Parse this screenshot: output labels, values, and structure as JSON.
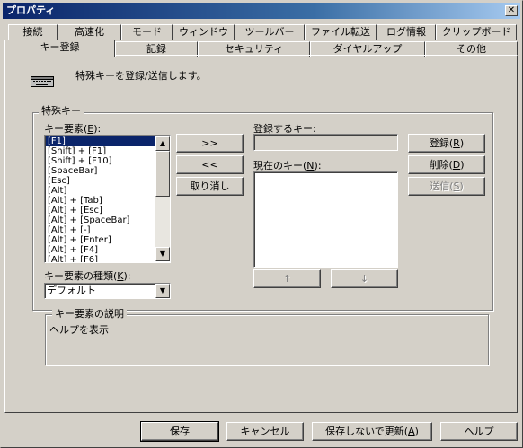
{
  "window": {
    "title": "プロパティ",
    "close": "✕"
  },
  "tabs_row1": [
    "接続",
    "高速化",
    "モード",
    "ウィンドウ",
    "ツールバー",
    "ファイル転送",
    "ログ情報",
    "クリップボード"
  ],
  "tabs_row2": [
    "キー登録",
    "記録",
    "セキュリティ",
    "ダイヤルアップ",
    "その他"
  ],
  "active_tab": "キー登録",
  "header": {
    "text": "特殊キーを登録/送信します。"
  },
  "group_special_key": {
    "title": "特殊キー"
  },
  "key_elements": {
    "label": "キー要素(E):",
    "label_plain": "キー要素(",
    "mnemonic": "E",
    "label_end": "):",
    "items": [
      "[F1]",
      "[Shift] + [F1]",
      "[Shift] + [F10]",
      "[SpaceBar]",
      "[Esc]",
      "[Alt]",
      "[Alt] + [Tab]",
      "[Alt] + [Esc]",
      "[Alt] + [SpaceBar]",
      "[Alt] + [-]",
      "[Alt] + [Enter]",
      "[Alt] + [F4]",
      "[Alt] + [F6]"
    ],
    "selected_index": 0
  },
  "key_type": {
    "label_plain": "キー要素の種類(",
    "mnemonic": "K",
    "label_end": "):",
    "value": "デフォルト"
  },
  "middle_buttons": {
    "add": ">>",
    "remove": "<<",
    "cancel": "取り消し"
  },
  "register_key": {
    "label": "登録するキー:",
    "value": ""
  },
  "current_key": {
    "label_plain": "現在のキー(",
    "mnemonic": "N",
    "label_end": "):"
  },
  "move_buttons": {
    "up": "↑",
    "down": "↓"
  },
  "right_buttons": {
    "register": {
      "plain": "登録(",
      "mnemonic": "R",
      "end": ")"
    },
    "delete": {
      "plain": "削除(",
      "mnemonic": "D",
      "end": ")"
    },
    "send": {
      "plain": "送信(",
      "mnemonic": "S",
      "end": ")"
    }
  },
  "description": {
    "title": "キー要素の説明",
    "text": "ヘルプを表示"
  },
  "footer": {
    "save": "保存",
    "cancel": "キャンセル",
    "update_plain": "保存しないで更新(",
    "update_mnemonic": "A",
    "update_end": ")",
    "help": "ヘルプ"
  },
  "icons": {
    "keyboard": "keyboard-icon",
    "dropdown": "chevron-down-icon",
    "scroll_up": "scroll-up-icon",
    "scroll_down": "scroll-down-icon"
  }
}
